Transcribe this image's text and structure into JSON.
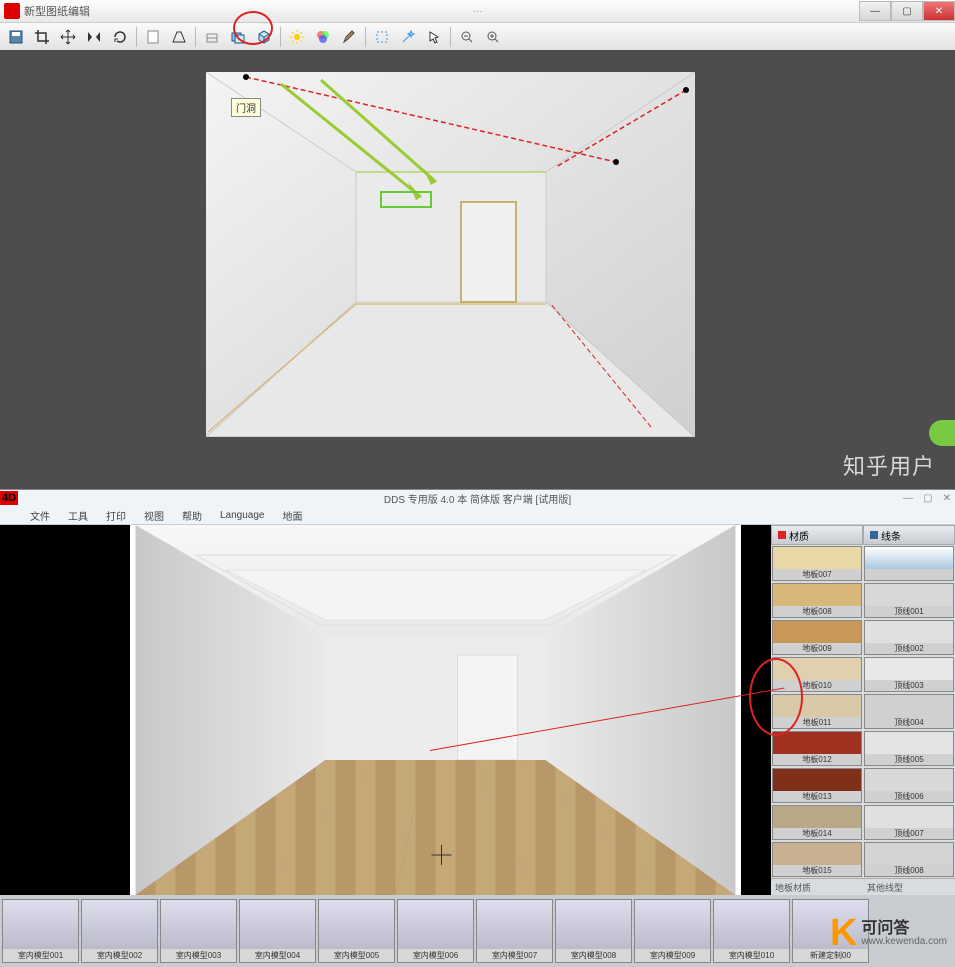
{
  "top": {
    "title": "新型图纸编辑",
    "titleCenter": "···",
    "tooltip": "门洞",
    "watermark": "知乎用户"
  },
  "bottom": {
    "logo": "4D",
    "titleCenter": "DDS 专用版 4.0 本 简体版 客户端 [试用版]",
    "menu": [
      "文件",
      "工具",
      "打印",
      "视图",
      "帮助",
      "Language",
      "地面"
    ],
    "panelA": {
      "title": "材质",
      "foot": "地板材质"
    },
    "panelB": {
      "title": "线条",
      "foot": "其他线型"
    },
    "swatchesA": [
      {
        "label": "地板007",
        "color": "#e8d8a8"
      },
      {
        "label": "地板008",
        "color": "#d8b878"
      },
      {
        "label": "地板009",
        "color": "#c89858"
      },
      {
        "label": "地板010",
        "color": "#e0d0b0"
      },
      {
        "label": "地板011",
        "color": "#d8c8a8"
      },
      {
        "label": "地板012",
        "color": "#a03020"
      },
      {
        "label": "地板013",
        "color": "#803018"
      },
      {
        "label": "地板014",
        "color": "#b8a888"
      },
      {
        "label": "地板015",
        "color": "#c8b090"
      }
    ],
    "swatchesB": [
      {
        "label": "",
        "color": "linear-gradient(#fff,#a8c8e0)"
      },
      {
        "label": "顶线001",
        "color": "#d8d8d8"
      },
      {
        "label": "顶线002",
        "color": "#e0e0e0"
      },
      {
        "label": "顶线003",
        "color": "#e8e8e8"
      },
      {
        "label": "顶线004",
        "color": "#d0d0d0"
      },
      {
        "label": "顶线005",
        "color": "#e4e4e4"
      },
      {
        "label": "顶线006",
        "color": "#d8d8d8"
      },
      {
        "label": "顶线007",
        "color": "#e0e0e0"
      },
      {
        "label": "顶线008",
        "color": "#d4d4d4"
      }
    ],
    "thumbs": [
      "室内模型001",
      "室内模型002",
      "室内模型003",
      "室内模型004",
      "室内模型005",
      "室内模型006",
      "室内模型007",
      "室内模型008",
      "室内模型009",
      "室内模型010",
      "新建定制00"
    ]
  },
  "site": {
    "cn": "可问答",
    "url": "www.kewenda.com",
    "k": "K"
  }
}
